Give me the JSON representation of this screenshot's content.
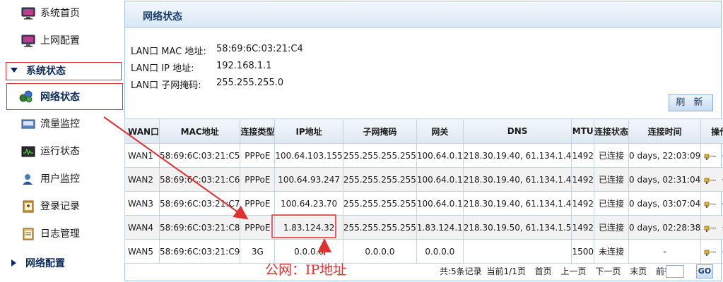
{
  "sidebar": {
    "items": [
      {
        "label": "系统首页",
        "icon": "monitor-icon"
      },
      {
        "label": "上网配置",
        "icon": "monitor-icon"
      }
    ],
    "section_status": {
      "label": "系统状态",
      "expanded": true
    },
    "status_items": [
      {
        "label": "网络状态",
        "icon": "globe-network-icon",
        "active": true
      },
      {
        "label": "流量监控",
        "icon": "traffic-icon"
      },
      {
        "label": "运行状态",
        "icon": "run-status-icon"
      },
      {
        "label": "用户监控",
        "icon": "user-icon"
      },
      {
        "label": "登录记录",
        "icon": "login-record-icon"
      },
      {
        "label": "日志管理",
        "icon": "log-icon"
      }
    ],
    "section_network": {
      "label": "网络配置",
      "expanded": false
    }
  },
  "panel": {
    "title": "网络状态",
    "lan": [
      {
        "key": "LAN口 MAC 地址:",
        "value": "58:69:6C:03:21:C4"
      },
      {
        "key": "LAN口 IP 地址:",
        "value": "192.168.1.1"
      },
      {
        "key": "LAN口 子网掩码:",
        "value": "255.255.255.0"
      }
    ],
    "refresh_label": "刷 新"
  },
  "wan_table": {
    "headers": [
      "WAN口",
      "MAC地址",
      "连接类型",
      "IP地址",
      "子网掩码",
      "网关",
      "DNS",
      "MTU",
      "连接状态",
      "连接时间",
      "操作"
    ],
    "rows": [
      [
        "WAN1",
        "58:69:6C:03:21:C5",
        "PPPoE",
        "100.64.103.155",
        "255.255.255.255",
        "100.64.0.1",
        "218.30.19.40, 61.134.1.4",
        "1492",
        "已连接",
        "0 days, 22:03:09"
      ],
      [
        "WAN2",
        "58:69:6C:03:21:C6",
        "PPPoE",
        "100.64.93.247",
        "255.255.255.255",
        "100.64.0.1",
        "218.30.19.40, 61.134.1.4",
        "1492",
        "已连接",
        "0 days, 02:31:04"
      ],
      [
        "WAN3",
        "58:69:6C:03:21:C7",
        "PPPoE",
        "100.64.23.70",
        "255.255.255.255",
        "100.64.0.1",
        "218.30.19.40, 61.134.1.4",
        "1492",
        "已连接",
        "0 days, 03:07:04"
      ],
      [
        "WAN4",
        "58:69:6C:03:21:C8",
        "PPPoE",
        "1.83.124.32",
        "255.255.255.255",
        "1.83.124.1",
        "218.30.19.50, 61.134.1.5",
        "1492",
        "已连接",
        "0 days, 02:28:38"
      ],
      [
        "WAN5",
        "58:69:6C:03:21:C9",
        "3G",
        "0.0.0.0",
        "0.0.0.0",
        "0.0.0.0",
        "",
        "1500",
        "未连接",
        "-"
      ]
    ]
  },
  "pager": {
    "summary": "共:5条记录",
    "current": "当前1/1页",
    "first": "首页",
    "prev": "上一页",
    "next": "下一页",
    "last": "末页",
    "goto": "前往第",
    "go": "GO"
  },
  "annotation": {
    "text": "公网：IP地址",
    "color": "#e03030"
  }
}
